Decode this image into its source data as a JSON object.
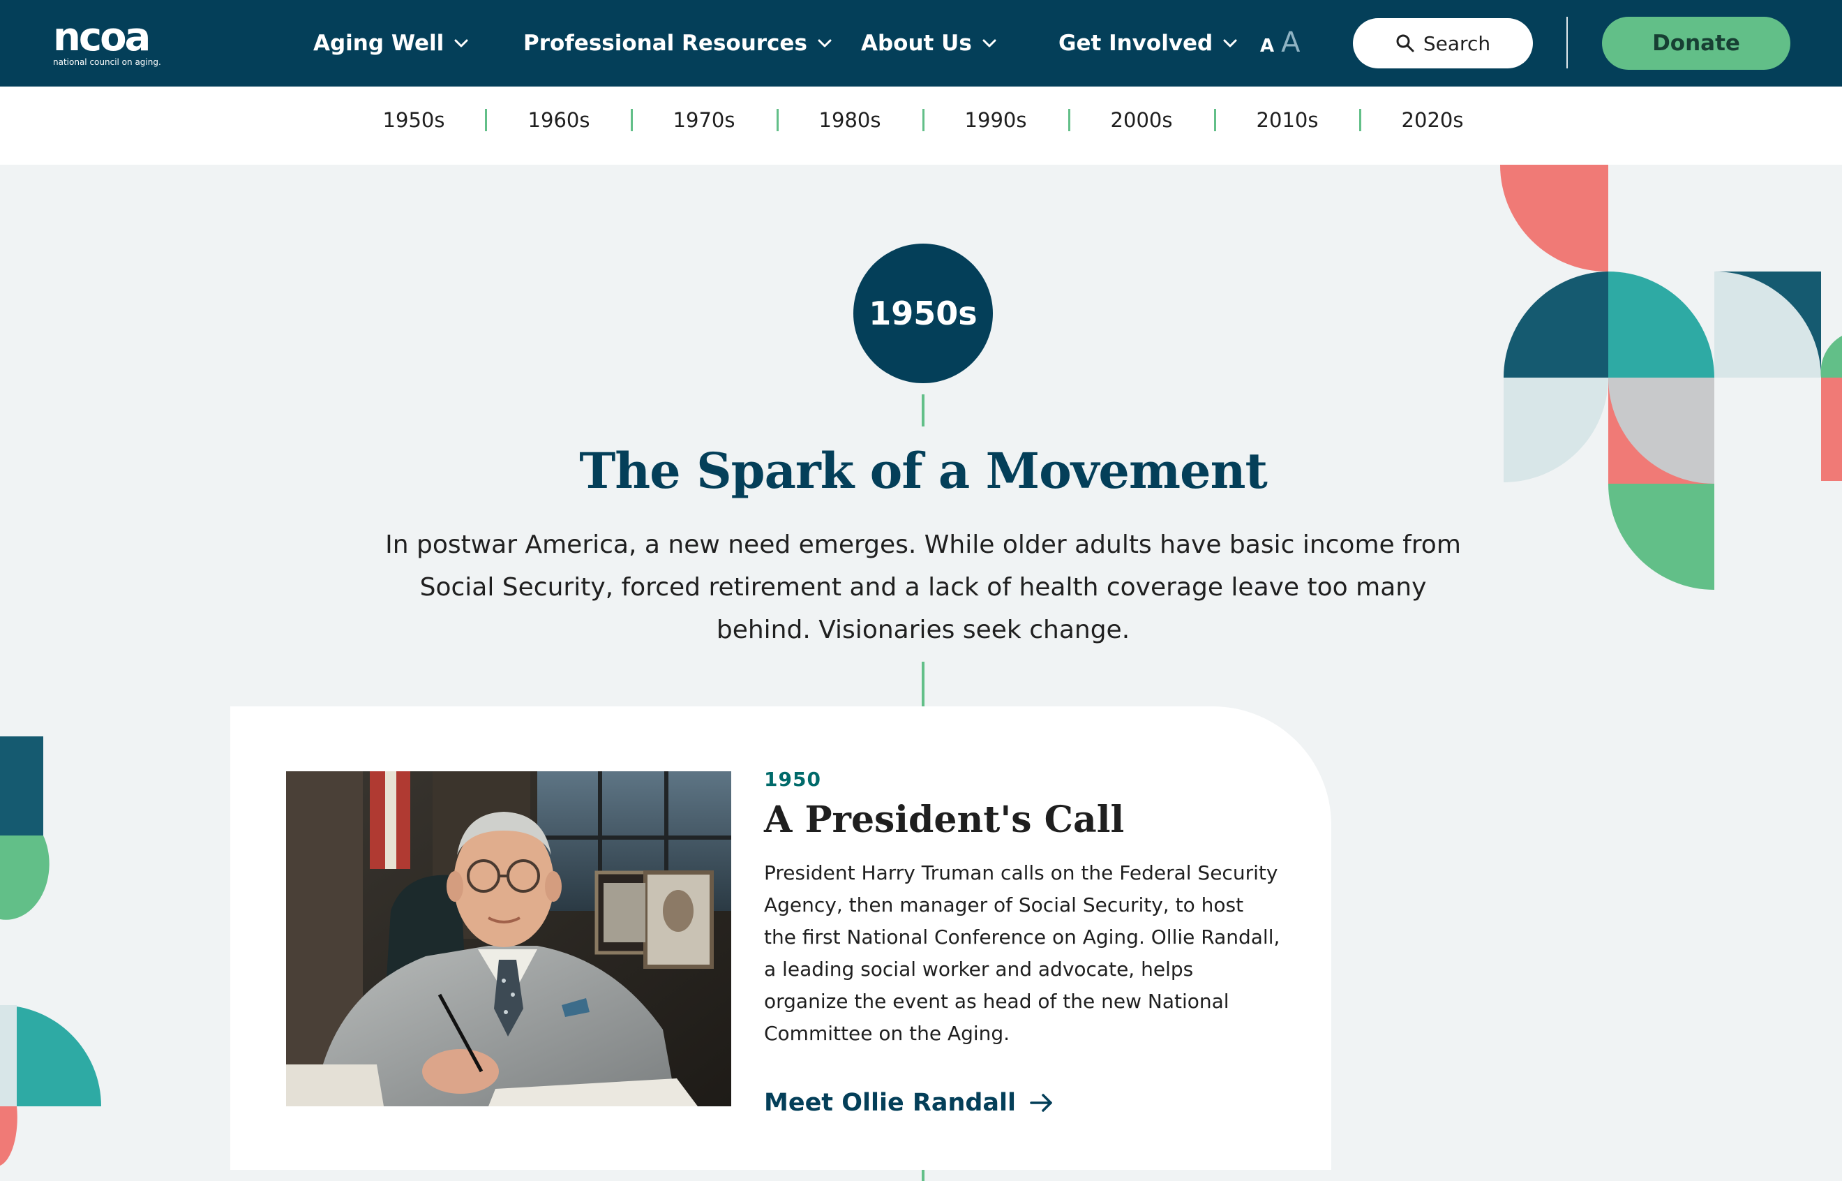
{
  "header": {
    "logo_mark": "ncoa",
    "logo_tagline": "national council on aging.",
    "nav": [
      {
        "label": "Aging Well"
      },
      {
        "label": "Professional Resources"
      },
      {
        "label": "About Us"
      },
      {
        "label": "Get Involved"
      }
    ],
    "font_small": "A",
    "font_large": "A",
    "search_label": "Search",
    "donate_label": "Donate"
  },
  "decades": [
    "1950s",
    "1960s",
    "1970s",
    "1980s",
    "1990s",
    "2000s",
    "2010s",
    "2020s"
  ],
  "hero": {
    "decade": "1950s",
    "title": "The Spark of a Movement",
    "text": "In postwar America, a new need emerges. While older adults have basic income from Social Security, forced retirement and a lack of health coverage leave too many behind. Visionaries seek change."
  },
  "card": {
    "year": "1950",
    "title": "A President's Call",
    "text": "President Harry Truman calls on the Federal Security Agency, then manager of Social Security, to host the first National Conference on Aging. Ollie Randall, a leading social worker and advocate, helps organize the event as head of the new National Committee on the Aging.",
    "link_label": "Meet Ollie Randall"
  },
  "colors": {
    "navy": "#043f59",
    "green": "#62bf88",
    "teal": "#2eaaa4",
    "coral": "#f07a76",
    "dark_teal": "#155a70",
    "light_teal": "#d8e6e8",
    "gray": "#c8c9cb",
    "background": "#f0f3f4"
  }
}
